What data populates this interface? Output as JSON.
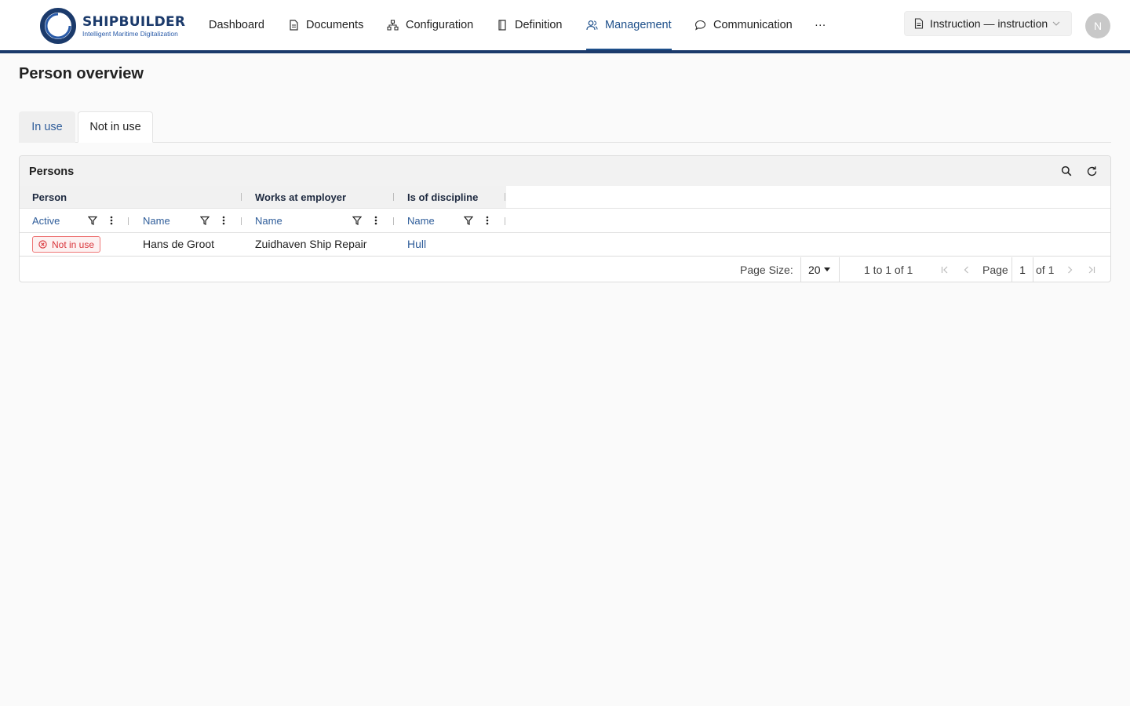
{
  "app": {
    "logo_name": "SHIPBUILDER",
    "logo_tagline": "Intelligent Maritime Digitalization",
    "brand_color": "#1b3a6b",
    "accent_color": "#1d4f8a"
  },
  "nav": {
    "items": [
      {
        "label": "Dashboard",
        "icon": "none",
        "active": false
      },
      {
        "label": "Documents",
        "icon": "document-icon",
        "active": false
      },
      {
        "label": "Configuration",
        "icon": "hierarchy-icon",
        "active": false
      },
      {
        "label": "Definition",
        "icon": "book-icon",
        "active": false
      },
      {
        "label": "Management",
        "icon": "users-icon",
        "active": true
      },
      {
        "label": "Communication",
        "icon": "chat-icon",
        "active": false
      }
    ],
    "more_label": "···"
  },
  "context_selector": {
    "label": "Instruction — instruction",
    "icon": "document-icon"
  },
  "user": {
    "initial": "N"
  },
  "page": {
    "title": "Person overview"
  },
  "tabs": [
    {
      "label": "In use",
      "active": false
    },
    {
      "label": "Not in use",
      "active": true
    }
  ],
  "grid": {
    "title": "Persons",
    "column_groups": [
      "Person",
      "Works at employer",
      "Is of discipline"
    ],
    "columns": [
      "Active",
      "Name",
      "Name",
      "Name"
    ],
    "rows": [
      {
        "active": "Not in use",
        "person_name": "Hans de Groot",
        "employer": "Zuidhaven Ship Repair",
        "discipline": "Hull"
      }
    ],
    "status_color": "#d9343a",
    "pager": {
      "page_size_label": "Page Size:",
      "page_size": "20",
      "range": "1 to 1 of 1",
      "page_label": "Page",
      "current_page": "1",
      "total_label": "of 1"
    }
  }
}
